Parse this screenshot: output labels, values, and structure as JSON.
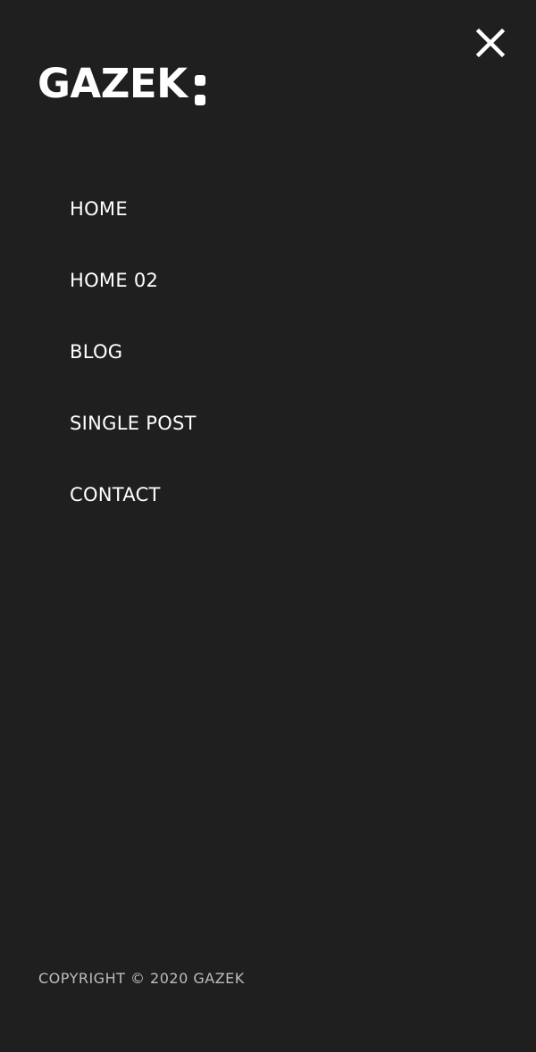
{
  "logo": {
    "text": "GAZEK"
  },
  "close": {
    "icon": "close-icon"
  },
  "nav": {
    "items": [
      {
        "label": "HOME"
      },
      {
        "label": "HOME 02"
      },
      {
        "label": "BLOG"
      },
      {
        "label": "SINGLE POST"
      },
      {
        "label": "CONTACT"
      }
    ]
  },
  "footer": {
    "copyright": "COPYRIGHT © 2020 GAZEK"
  },
  "colors": {
    "background": "#1f1f1f",
    "text": "#ffffff",
    "muted_text": "#bdbdbd"
  }
}
